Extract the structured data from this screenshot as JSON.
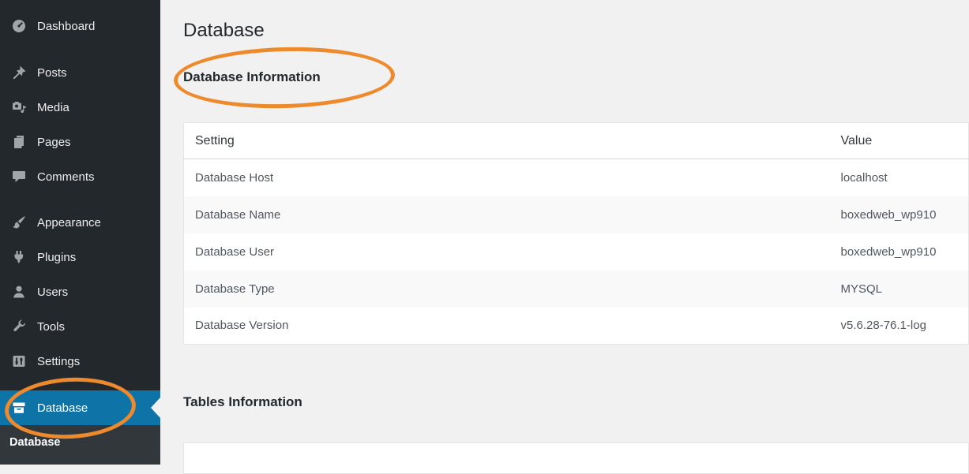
{
  "sidebar": {
    "items": [
      {
        "label": "Dashboard",
        "icon": "dashboard-icon",
        "active": false
      },
      {
        "label": "Posts",
        "icon": "pushpin-icon",
        "active": false
      },
      {
        "label": "Media",
        "icon": "camera-icon",
        "active": false
      },
      {
        "label": "Pages",
        "icon": "pages-icon",
        "active": false
      },
      {
        "label": "Comments",
        "icon": "comment-icon",
        "active": false
      },
      {
        "label": "Appearance",
        "icon": "brush-icon",
        "active": false
      },
      {
        "label": "Plugins",
        "icon": "plug-icon",
        "active": false
      },
      {
        "label": "Users",
        "icon": "user-icon",
        "active": false
      },
      {
        "label": "Tools",
        "icon": "wrench-icon",
        "active": false
      },
      {
        "label": "Settings",
        "icon": "sliders-icon",
        "active": false
      },
      {
        "label": "Database",
        "icon": "database-icon",
        "active": true
      }
    ],
    "submenu_item": "Database"
  },
  "main": {
    "page_title": "Database",
    "db_info_heading": "Database Information",
    "tables_info_heading": "Tables Information",
    "db_table": {
      "headers": [
        "Setting",
        "Value"
      ],
      "rows": [
        {
          "setting": "Database Host",
          "value": "localhost"
        },
        {
          "setting": "Database Name",
          "value": "boxedweb_wp910"
        },
        {
          "setting": "Database User",
          "value": "boxedweb_wp910"
        },
        {
          "setting": "Database Type",
          "value": "MYSQL"
        },
        {
          "setting": "Database Version",
          "value": "v5.6.28-76.1-log"
        }
      ]
    }
  },
  "colors": {
    "sidebar_bg": "#23282d",
    "submenu_bg": "#32373c",
    "active_blue": "#0e74a8",
    "content_bg": "#f1f1f1",
    "annotation_orange": "#ee8a2e"
  }
}
